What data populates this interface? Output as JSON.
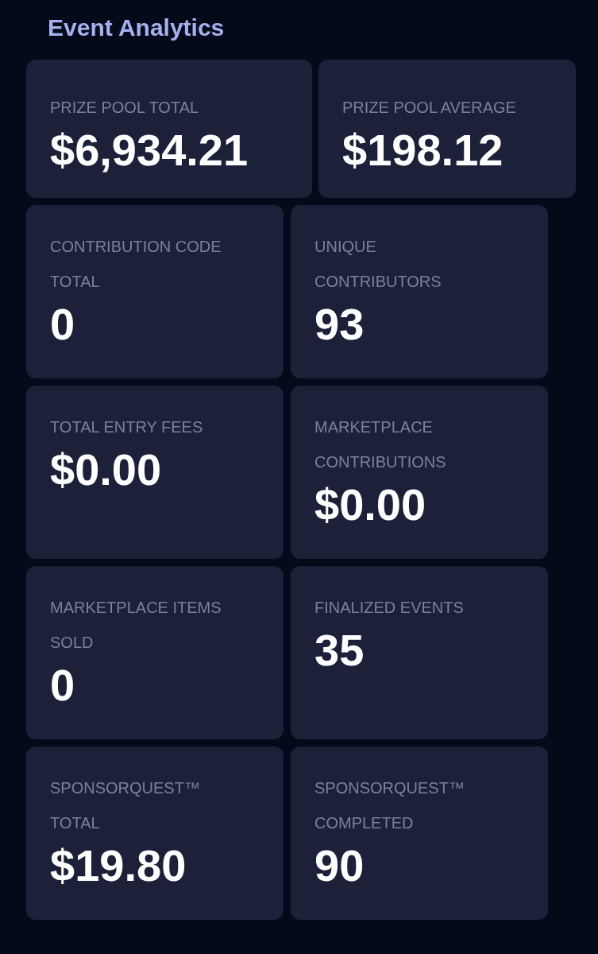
{
  "title": "Event Analytics",
  "top_cards": [
    {
      "label_lines": [
        "PRIZE POOL TOTAL"
      ],
      "value": "$6,934.21"
    },
    {
      "label_lines": [
        "PRIZE POOL AVERAGE"
      ],
      "value": "$198.12"
    }
  ],
  "cards": [
    {
      "label_lines": [
        "CONTRIBUTION CODE",
        "TOTAL"
      ],
      "value": "0"
    },
    {
      "label_lines": [
        "UNIQUE",
        "CONTRIBUTORS"
      ],
      "value": "93"
    },
    {
      "label_lines": [
        "TOTAL ENTRY FEES"
      ],
      "value": "$0.00"
    },
    {
      "label_lines": [
        "MARKETPLACE",
        "CONTRIBUTIONS"
      ],
      "value": "$0.00"
    },
    {
      "label_lines": [
        "MARKETPLACE ITEMS",
        "SOLD"
      ],
      "value": "0"
    },
    {
      "label_lines": [
        "FINALIZED EVENTS"
      ],
      "value": "35"
    },
    {
      "label_lines": [
        "SPONSORQUEST™",
        "TOTAL"
      ],
      "value": "$19.80"
    },
    {
      "label_lines": [
        "SPONSORQUEST™",
        "COMPLETED"
      ],
      "value": "90"
    }
  ]
}
